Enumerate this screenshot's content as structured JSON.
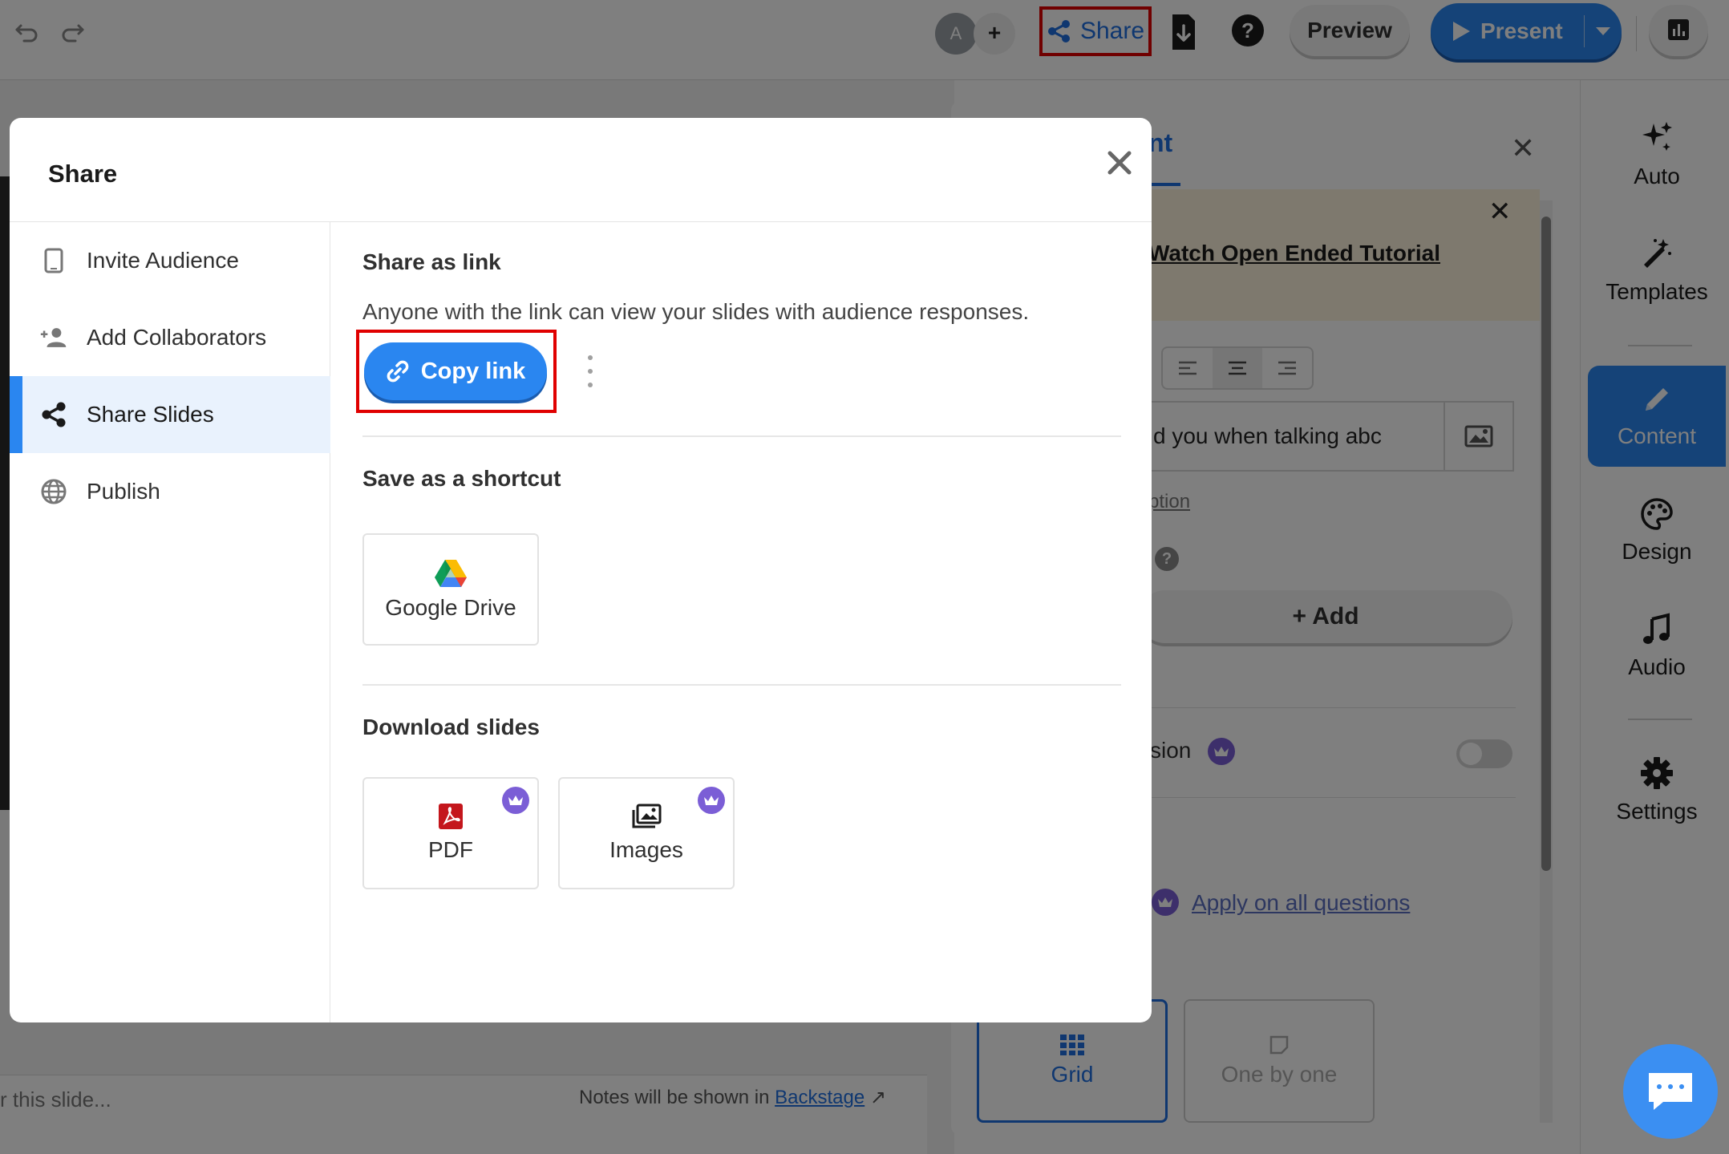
{
  "topbar": {
    "avatar_initial": "A",
    "add_label": "+",
    "share_label": "Share",
    "help_label": "?",
    "preview_label": "Preview",
    "present_label": "Present"
  },
  "panel": {
    "tab_title": "nt",
    "tutorial_link": "Watch Open Ended Tutorial",
    "option_text": "d you when talking abc",
    "option_link": "ption",
    "help_label": "?",
    "add_label": "+ Add",
    "session_label": "ssion",
    "apply_link": "Apply on all questions",
    "layout_grid": "Grid",
    "layout_one_by_one": "One by one"
  },
  "rail": {
    "items": [
      {
        "label": "Auto",
        "icon": "sparkle-icon"
      },
      {
        "label": "Templates",
        "icon": "magic-wand-icon"
      },
      {
        "label": "Content",
        "icon": "pencil-icon"
      },
      {
        "label": "Design",
        "icon": "palette-icon"
      },
      {
        "label": "Audio",
        "icon": "music-note-icon"
      },
      {
        "label": "Settings",
        "icon": "gear-icon"
      }
    ]
  },
  "notes": {
    "placeholder": "r this slide...",
    "hint": "Notes will be shown in",
    "hint_link": "Backstage"
  },
  "modal": {
    "title": "Share",
    "nav": [
      {
        "label": "Invite Audience",
        "icon": "tablet-icon"
      },
      {
        "label": "Add Collaborators",
        "icon": "add-user-icon"
      },
      {
        "label": "Share Slides",
        "icon": "share-icon"
      },
      {
        "label": "Publish",
        "icon": "globe-icon"
      }
    ],
    "share_link": {
      "title": "Share as link",
      "description": "Anyone with the link can view your slides with audience responses.",
      "copy_label": "Copy link"
    },
    "shortcut": {
      "title": "Save as a shortcut",
      "google_drive": "Google Drive"
    },
    "download": {
      "title": "Download slides",
      "pdf": "PDF",
      "images": "Images"
    }
  },
  "colors": {
    "accent": "#2a86f0",
    "highlight": "#e00000",
    "premium": "#7b5ed6",
    "overlay": "rgba(0,0,0,0.5)"
  }
}
